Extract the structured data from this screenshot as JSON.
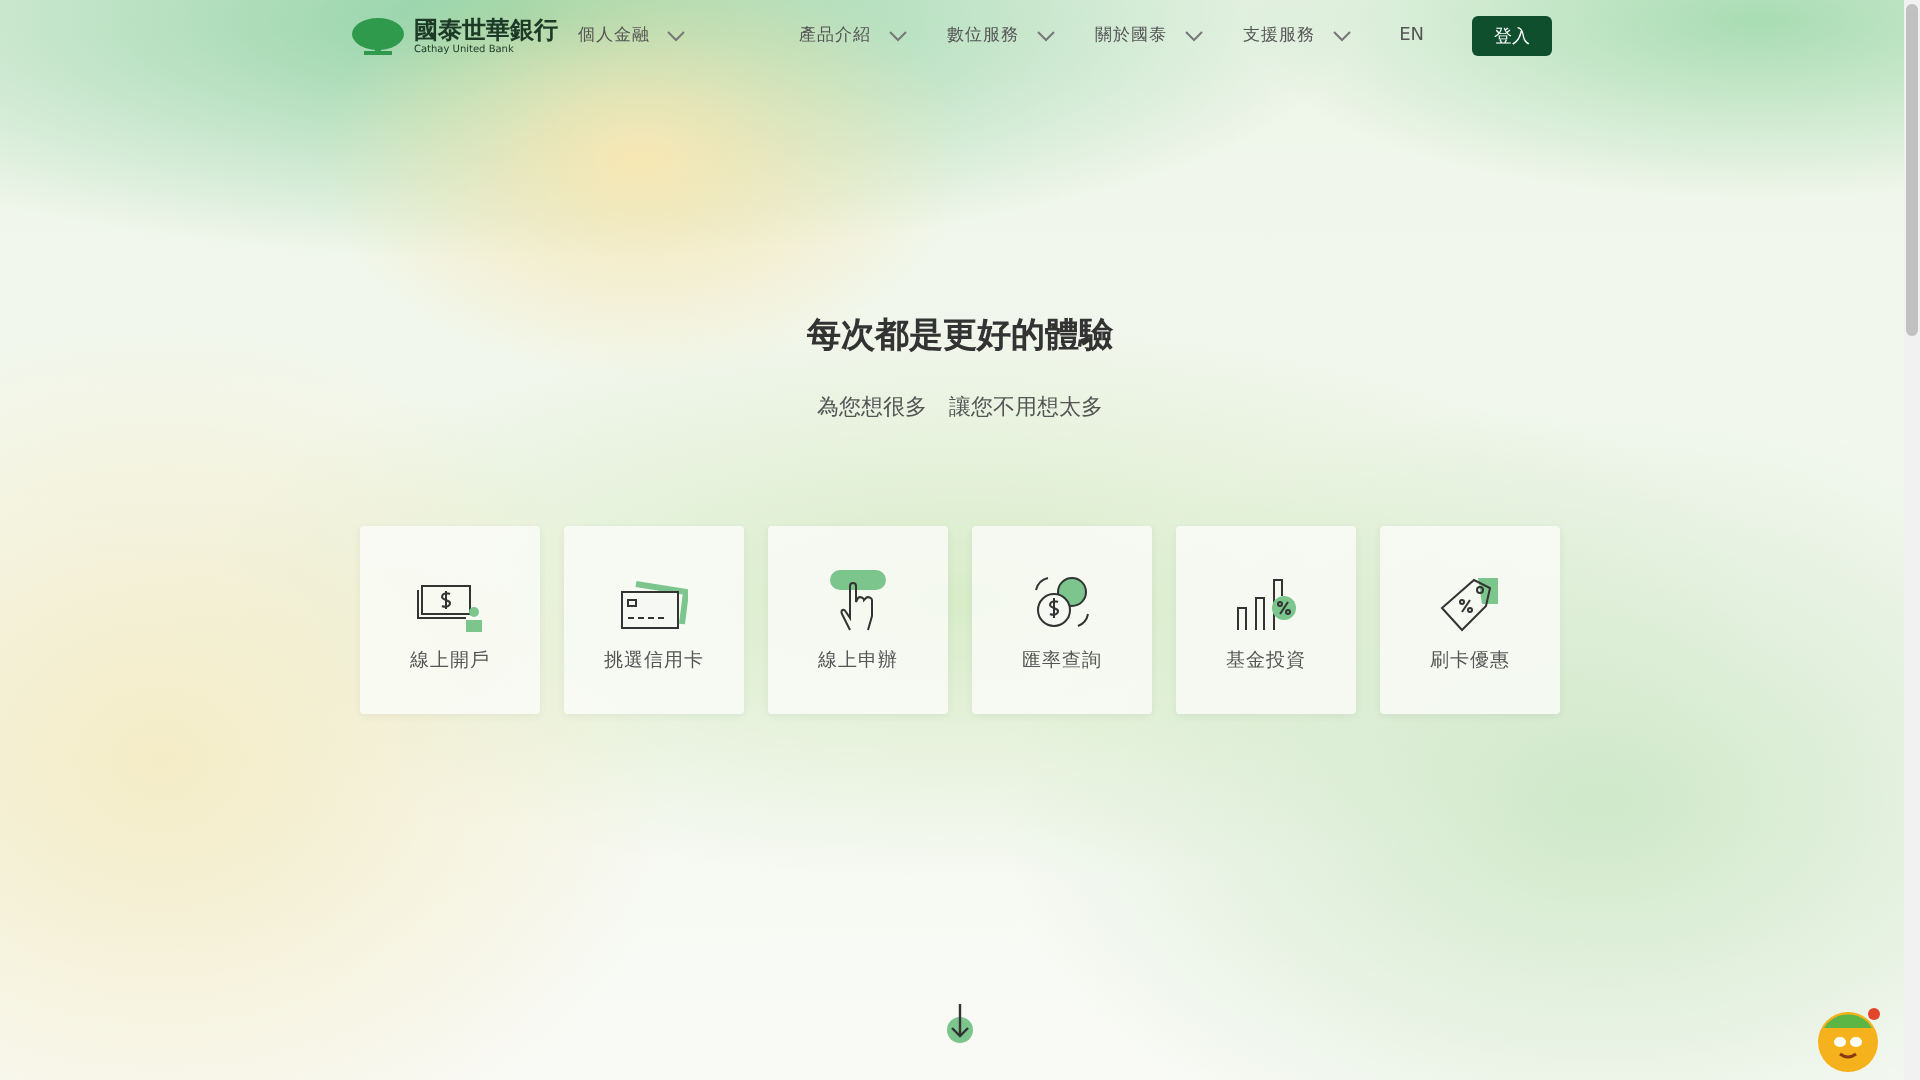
{
  "header": {
    "logo_name": "國泰世華銀行",
    "logo_sub": "Cathay United Bank",
    "segment": "個人金融",
    "nav": [
      {
        "label": "產品介紹"
      },
      {
        "label": "數位服務"
      },
      {
        "label": "關於國泰"
      },
      {
        "label": "支援服務"
      }
    ],
    "language": "EN",
    "login": "登入"
  },
  "hero": {
    "title": "每次都是更好的體驗",
    "subtitle": "為您想很多　讓您不用想太多"
  },
  "cards": [
    {
      "kind": "account",
      "label": "線上開戶"
    },
    {
      "kind": "card",
      "label": "挑選信用卡"
    },
    {
      "kind": "tap",
      "label": "線上申辦"
    },
    {
      "kind": "exchange",
      "label": "匯率查詢"
    },
    {
      "kind": "fund",
      "label": "基金投資"
    },
    {
      "kind": "tag",
      "label": "刷卡優惠"
    }
  ]
}
